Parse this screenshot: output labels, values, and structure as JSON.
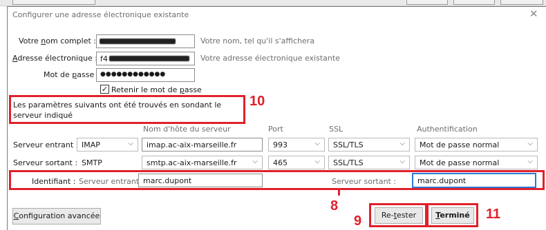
{
  "window": {
    "title": "Configurer une adresse électronique existante",
    "close_glyph": "✕"
  },
  "account": {
    "name_label_pre": "Votre ",
    "name_label_u": "n",
    "name_label_post": "om complet :",
    "name_hint": "Votre nom, tel qu'il s'affichera",
    "email_label_u": "A",
    "email_label_post": "dresse électronique :",
    "email_value_prefix": "f4",
    "email_hint": "Votre adresse électronique existante",
    "password_label_pre": "Mot de ",
    "password_label_u": "p",
    "password_label_post": "asse :",
    "password_value": "●●●●●●●●●●●●",
    "remember_checked": "✓",
    "remember_label_pre": "Retenir le mot de ",
    "remember_label_u": "p",
    "remember_label_post": "asse"
  },
  "notice": {
    "text": "Les paramètres suivants ont été trouvés en sondant le serveur indiqué"
  },
  "columns": {
    "hostname": "Nom d'hôte du serveur",
    "port": "Port",
    "ssl": "SSL",
    "auth": "Authentification"
  },
  "incoming": {
    "label": "Serveur entrant :",
    "protocol": "IMAP",
    "hostname": "imap.ac-aix-marseille.fr",
    "port": "993",
    "ssl": "SSL/TLS",
    "auth": "Mot de passe normal"
  },
  "outgoing": {
    "label": "Serveur sortant :",
    "protocol": "SMTP",
    "hostname": "smtp.ac-aix-marseille.fr",
    "port": "465",
    "ssl": "SSL/TLS",
    "auth": "Mot de passe normal"
  },
  "identifier": {
    "label": "Identifiant :",
    "incoming_label": "Serveur entrant :",
    "incoming_value": "marc.dupont",
    "outgoing_label": "Serveur sortant :",
    "outgoing_value": "marc.dupont"
  },
  "buttons": {
    "advanced_u": "C",
    "advanced_post": "onfiguration avancée",
    "retest_pre": "Re-",
    "retest_u": "t",
    "retest_post": "ester",
    "done_u": "T",
    "done_post": "erminé"
  },
  "annotations": {
    "n8": "8",
    "n9": "9",
    "n10": "10",
    "n11": "11"
  },
  "colors": {
    "annotation": "#e0202b",
    "focus": "#2a7ad6"
  },
  "icons": {
    "chevron": "chevron-down-icon",
    "close": "close-icon",
    "check": "check-icon"
  }
}
